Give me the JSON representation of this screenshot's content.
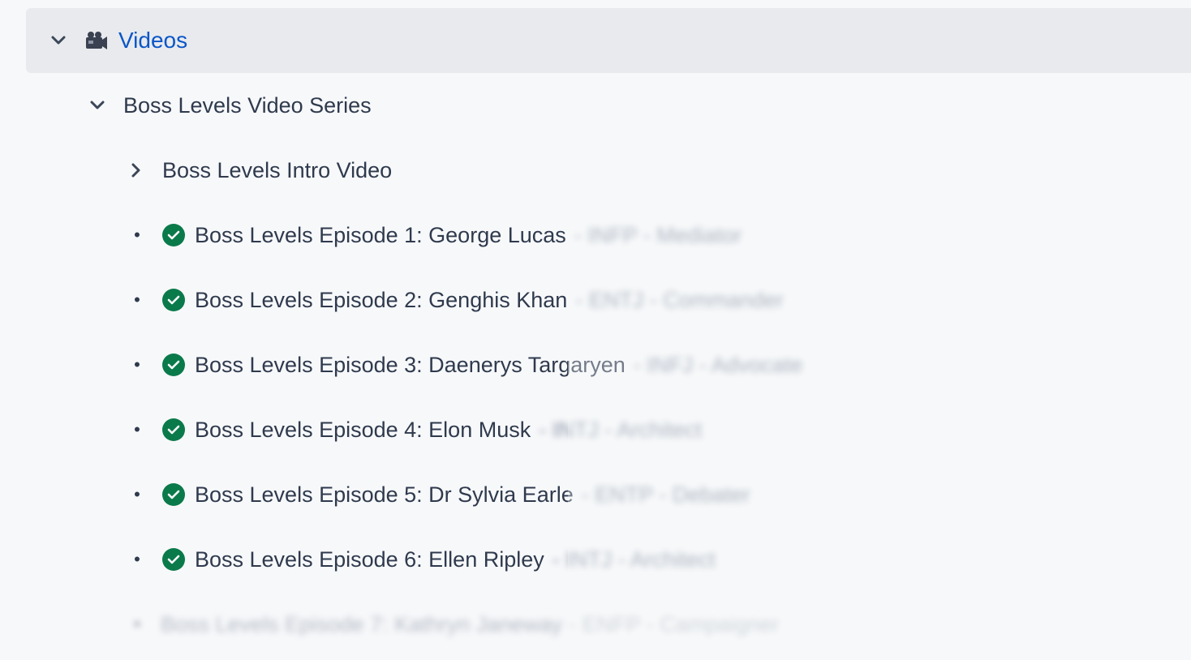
{
  "tree": {
    "root": {
      "label": "Videos",
      "icon": "video-camera-icon",
      "expanded": true
    },
    "series": {
      "label": "Boss Levels Video Series",
      "expanded": true
    },
    "intro": {
      "label": "Boss Levels Intro Video",
      "expanded": false
    },
    "episodes": [
      {
        "title": "Boss Levels Episode 1: George Lucas",
        "meta": "- INFP - Mediator",
        "completed": true
      },
      {
        "title": "Boss Levels Episode 2: Genghis Khan",
        "meta": "- ENTJ - Commander",
        "completed": true
      },
      {
        "title": "Boss Levels Episode 3: Daenerys Targaryen",
        "meta": "- INFJ - Advocate",
        "completed": true
      },
      {
        "title": "Boss Levels Episode 4: Elon Musk",
        "meta": "- INTJ - Architect",
        "completed": true
      },
      {
        "title": "Boss Levels Episode 5: Dr Sylvia Earle",
        "meta": "- ENTP - Debater",
        "completed": true
      },
      {
        "title": "Boss Levels Episode 6: Ellen Ripley",
        "meta": "- INTJ - Architect",
        "completed": true
      },
      {
        "title": "Boss Levels Episode 7: Kathryn Janeway",
        "meta": "- ENFP - Campaigner",
        "completed": false
      }
    ]
  },
  "colors": {
    "background": "#f7f8fa",
    "root_row": "#e8eaee",
    "link": "#0b56c7",
    "text": "#2f3a4d",
    "check": "#0a7a4a"
  }
}
